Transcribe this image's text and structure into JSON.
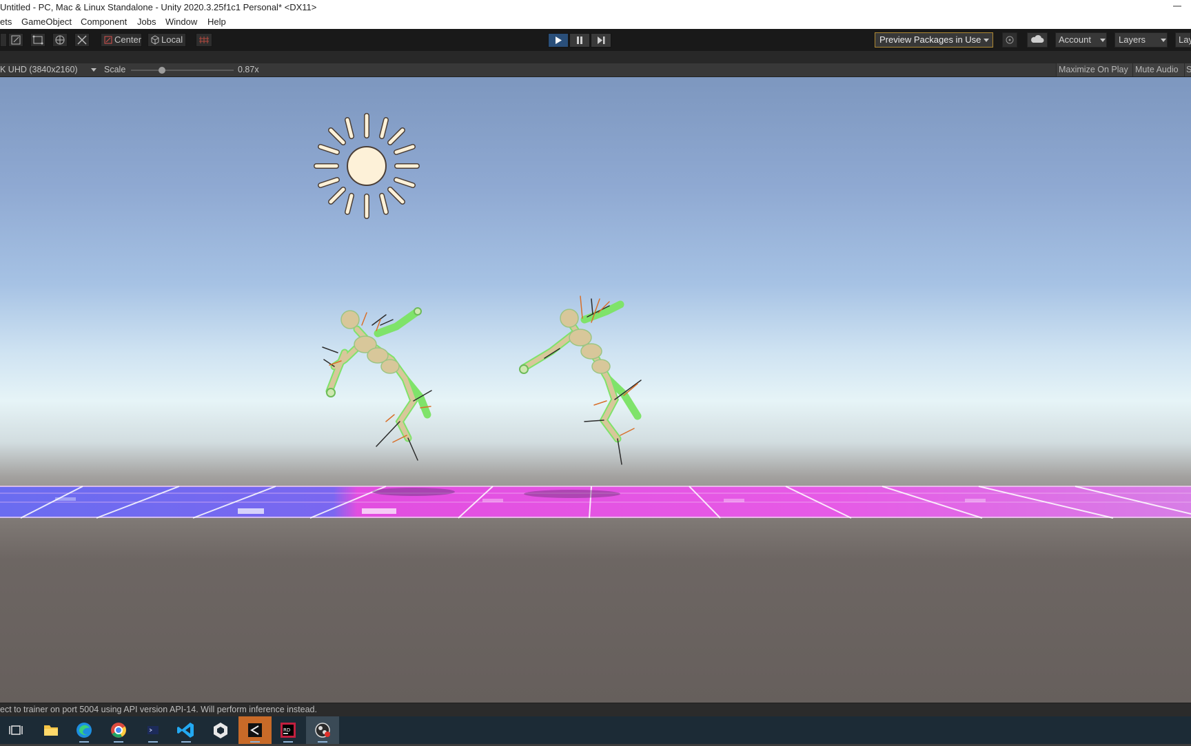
{
  "title": "Untitled - PC, Mac & Linux Standalone - Unity 2020.3.25f1c1 Personal* <DX11>",
  "menu": [
    "ets",
    "GameObject",
    "Component",
    "Jobs",
    "Window",
    "Help"
  ],
  "toolbar": {
    "pivot_label": "Center",
    "space_label": "Local",
    "preview_packages": "Preview Packages in Use",
    "account": "Account",
    "layers": "Layers",
    "layout": "Lay"
  },
  "game_view": {
    "resolution": "K UHD (3840x2160)",
    "scale_label": "Scale",
    "scale_value": "0.87x",
    "scale_fraction": 0.3,
    "maximize_on_play": "Maximize On Play",
    "mute_audio": "Mute Audio",
    "stats": "S"
  },
  "status": {
    "message": "ect to trainer on port 5004 using API version API-14. Will perform inference instead."
  },
  "colors": {
    "sky_top": "#7d97bf",
    "horizon": "#e6f4f7",
    "ground": "#665f5c",
    "floor_blue": "#6a6cf0",
    "floor_magenta": "#e24ee0",
    "agent_green": "#7fe36a",
    "agent_body": "#d8c79a",
    "sun": "#fdf1d8",
    "play_active": "#2a4f7a"
  },
  "taskbar": [
    "task-view-icon",
    "file-explorer-icon",
    "edge-icon",
    "chrome-icon",
    "terminal-icon",
    "vscode-icon",
    "unity-hub-icon",
    "unity-editor-icon",
    "rider-icon",
    "obs-icon"
  ]
}
